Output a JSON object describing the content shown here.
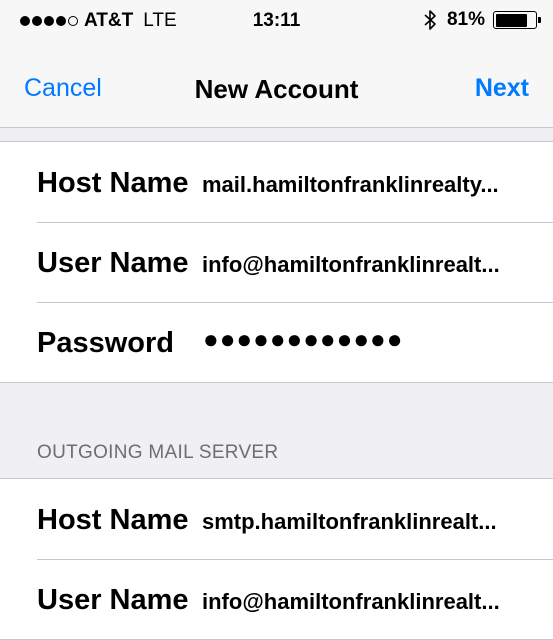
{
  "status_bar": {
    "signal_bars_filled": 4,
    "signal_bars_total": 5,
    "carrier": "AT&T",
    "network": "LTE",
    "time": "13:11",
    "battery_percent": "81%",
    "battery_level": 0.81,
    "bluetooth_icon": "bluetooth-icon"
  },
  "nav": {
    "cancel_label": "Cancel",
    "title": "New Account",
    "next_label": "Next"
  },
  "incoming_server": {
    "rows": [
      {
        "label": "Host Name",
        "value": "mail.hamiltonfranklinrealty..."
      },
      {
        "label": "User Name",
        "value": "info@hamiltonfranklinrealt..."
      },
      {
        "label": "Password",
        "value": "●●●●●●●●●●●●"
      }
    ]
  },
  "outgoing_server": {
    "header": "OUTGOING MAIL SERVER",
    "rows": [
      {
        "label": "Host Name",
        "value": "smtp.hamiltonfranklinrealt..."
      },
      {
        "label": "User Name",
        "value": "info@hamiltonfranklinrealt..."
      }
    ]
  },
  "colors": {
    "accent": "#007aff",
    "background": "#efeff4",
    "separator": "#c8c7cc",
    "section_header": "#6d6d72"
  }
}
